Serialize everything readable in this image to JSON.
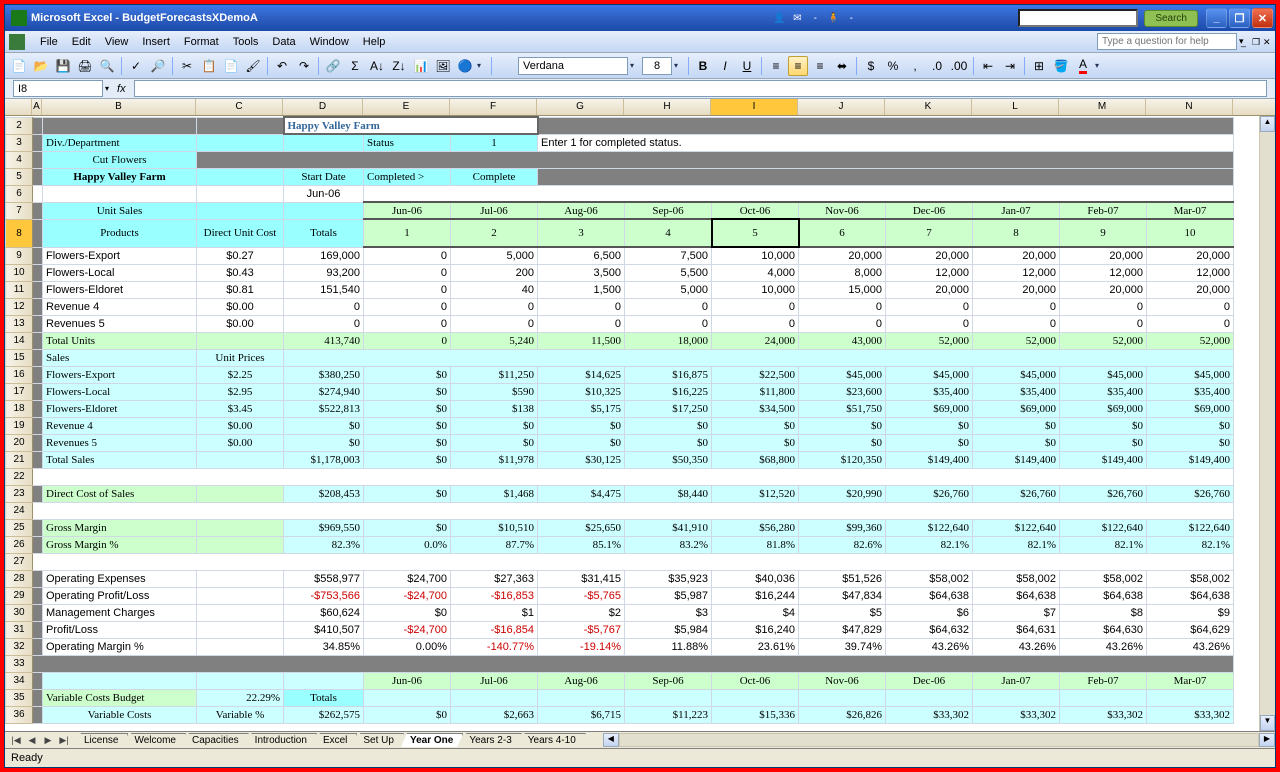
{
  "title": "Microsoft Excel - BudgetForecastsXDemoA",
  "search_btn": "Search",
  "menus": [
    "File",
    "Edit",
    "View",
    "Insert",
    "Format",
    "Tools",
    "Data",
    "Window",
    "Help"
  ],
  "help_placeholder": "Type a question for help",
  "font_name": "Verdana",
  "font_size": "8",
  "namebox": "I8",
  "columns": [
    "A",
    "B",
    "C",
    "D",
    "E",
    "F",
    "G",
    "H",
    "I",
    "J",
    "K",
    "L",
    "M",
    "N"
  ],
  "active_col": "I",
  "row_nums": [
    "2",
    "3",
    "4",
    "5",
    "6",
    "7",
    "8",
    "9",
    "10",
    "11",
    "12",
    "13",
    "14",
    "15",
    "16",
    "17",
    "18",
    "19",
    "20",
    "21",
    "22",
    "23",
    "24",
    "25",
    "26",
    "27",
    "28",
    "29",
    "30",
    "31",
    "32",
    "33",
    "34",
    "35",
    "36"
  ],
  "active_row": "8",
  "company": "Happy Valley Farm",
  "div_label": "Div./Department",
  "cut_flowers": "Cut Flowers",
  "status_label": "Status",
  "status_val": "1",
  "status_note": "Enter 1 for completed status.",
  "start_date": "Start Date",
  "completed_arrow": "Completed >",
  "completed": "Complete",
  "month0": "Jun-06",
  "unit_sales": "Unit Sales",
  "products": "Products",
  "direct_cost": "Direct Unit Cost",
  "totals": "Totals",
  "months": [
    "Jun-06",
    "Jul-06",
    "Aug-06",
    "Sep-06",
    "Oct-06",
    "Nov-06",
    "Dec-06",
    "Jan-07",
    "Feb-07",
    "Mar-07"
  ],
  "month_nums": [
    "1",
    "2",
    "3",
    "4",
    "5",
    "6",
    "7",
    "8",
    "9",
    "10"
  ],
  "chart_data": {
    "type": "table",
    "rows": [
      {
        "label": "Flowers-Export",
        "cost": "$0.27",
        "total": "169,000",
        "vals": [
          "0",
          "5,000",
          "6,500",
          "7,500",
          "10,000",
          "20,000",
          "20,000",
          "20,000",
          "20,000",
          "20,000"
        ]
      },
      {
        "label": "Flowers-Local",
        "cost": "$0.43",
        "total": "93,200",
        "vals": [
          "0",
          "200",
          "3,500",
          "5,500",
          "4,000",
          "8,000",
          "12,000",
          "12,000",
          "12,000",
          "12,000"
        ]
      },
      {
        "label": "Flowers-Eldoret",
        "cost": "$0.81",
        "total": "151,540",
        "vals": [
          "0",
          "40",
          "1,500",
          "5,000",
          "10,000",
          "15,000",
          "20,000",
          "20,000",
          "20,000",
          "20,000"
        ]
      },
      {
        "label": "Revenue 4",
        "cost": "$0.00",
        "total": "0",
        "vals": [
          "0",
          "0",
          "0",
          "0",
          "0",
          "0",
          "0",
          "0",
          "0",
          "0"
        ]
      },
      {
        "label": "Revenues 5",
        "cost": "$0.00",
        "total": "0",
        "vals": [
          "0",
          "0",
          "0",
          "0",
          "0",
          "0",
          "0",
          "0",
          "0",
          "0"
        ]
      }
    ],
    "total_units": {
      "label": "Total Units",
      "total": "413,740",
      "vals": [
        "0",
        "5,240",
        "11,500",
        "18,000",
        "24,000",
        "43,000",
        "52,000",
        "52,000",
        "52,000",
        "52,000"
      ]
    },
    "sales_hdr": "Sales",
    "unit_prices": "Unit Prices",
    "sales": [
      {
        "label": "Flowers-Export",
        "price": "$2.25",
        "total": "$380,250",
        "vals": [
          "$0",
          "$11,250",
          "$14,625",
          "$16,875",
          "$22,500",
          "$45,000",
          "$45,000",
          "$45,000",
          "$45,000",
          "$45,000"
        ]
      },
      {
        "label": "Flowers-Local",
        "price": "$2.95",
        "total": "$274,940",
        "vals": [
          "$0",
          "$590",
          "$10,325",
          "$16,225",
          "$11,800",
          "$23,600",
          "$35,400",
          "$35,400",
          "$35,400",
          "$35,400"
        ]
      },
      {
        "label": "Flowers-Eldoret",
        "price": "$3.45",
        "total": "$522,813",
        "vals": [
          "$0",
          "$138",
          "$5,175",
          "$17,250",
          "$34,500",
          "$51,750",
          "$69,000",
          "$69,000",
          "$69,000",
          "$69,000"
        ]
      },
      {
        "label": "Revenue 4",
        "price": "$0.00",
        "total": "$0",
        "vals": [
          "$0",
          "$0",
          "$0",
          "$0",
          "$0",
          "$0",
          "$0",
          "$0",
          "$0",
          "$0"
        ]
      },
      {
        "label": "Revenues 5",
        "price": "$0.00",
        "total": "$0",
        "vals": [
          "$0",
          "$0",
          "$0",
          "$0",
          "$0",
          "$0",
          "$0",
          "$0",
          "$0",
          "$0"
        ]
      }
    ],
    "total_sales": {
      "label": "Total Sales",
      "total": "$1,178,003",
      "vals": [
        "$0",
        "$11,978",
        "$30,125",
        "$50,350",
        "$68,800",
        "$120,350",
        "$149,400",
        "$149,400",
        "$149,400",
        "$149,400"
      ]
    },
    "dcs": {
      "label": "Direct Cost of Sales",
      "total": "$208,453",
      "vals": [
        "$0",
        "$1,468",
        "$4,475",
        "$8,440",
        "$12,520",
        "$20,990",
        "$26,760",
        "$26,760",
        "$26,760",
        "$26,760"
      ]
    },
    "gm": {
      "label": "Gross Margin",
      "total": "$969,550",
      "vals": [
        "$0",
        "$10,510",
        "$25,650",
        "$41,910",
        "$56,280",
        "$99,360",
        "$122,640",
        "$122,640",
        "$122,640",
        "$122,640"
      ]
    },
    "gmp": {
      "label": "Gross Margin %",
      "total": "82.3%",
      "vals": [
        "0.0%",
        "87.7%",
        "85.1%",
        "83.2%",
        "81.8%",
        "82.6%",
        "82.1%",
        "82.1%",
        "82.1%",
        "82.1%"
      ]
    },
    "opex": {
      "label": "Operating Expenses",
      "total": "$558,977",
      "vals": [
        "$24,700",
        "$27,363",
        "$31,415",
        "$35,923",
        "$40,036",
        "$51,526",
        "$58,002",
        "$58,002",
        "$58,002",
        "$58,002"
      ]
    },
    "opl": {
      "label": "Operating Profit/Loss",
      "total": "-$753,566",
      "vals": [
        "-$24,700",
        "-$16,853",
        "-$5,765",
        "$5,987",
        "$16,244",
        "$47,834",
        "$64,638",
        "$64,638",
        "$64,638",
        "$64,638"
      ],
      "neg": [
        true,
        true,
        true,
        true,
        false,
        false,
        false,
        false,
        false,
        false,
        false
      ]
    },
    "mc": {
      "label": "Management Charges",
      "total": "$60,624",
      "vals": [
        "$0",
        "$1",
        "$2",
        "$3",
        "$4",
        "$5",
        "$6",
        "$7",
        "$8",
        "$9"
      ]
    },
    "pl": {
      "label": "Profit/Loss",
      "total": "$410,507",
      "vals": [
        "-$24,700",
        "-$16,854",
        "-$5,767",
        "$5,984",
        "$16,240",
        "$47,829",
        "$64,632",
        "$64,631",
        "$64,630",
        "$64,629"
      ],
      "neg": [
        false,
        true,
        true,
        true,
        false,
        false,
        false,
        false,
        false,
        false,
        false
      ]
    },
    "omp": {
      "label": "Operating Margin %",
      "total": "34.85%",
      "vals": [
        "0.00%",
        "-140.77%",
        "-19.14%",
        "11.88%",
        "23.61%",
        "39.74%",
        "43.26%",
        "43.26%",
        "43.26%",
        "43.26%"
      ],
      "neg": [
        false,
        false,
        true,
        true,
        false,
        false,
        false,
        false,
        false,
        false,
        false
      ]
    },
    "vcb": {
      "label": "Variable Costs Budget",
      "pct": "22.29%",
      "totals": "Totals"
    },
    "vc": {
      "label": "Variable Costs",
      "sub": "Variable %",
      "total": "$262,575",
      "vals": [
        "$0",
        "$2,663",
        "$6,715",
        "$11,223",
        "$15,336",
        "$26,826",
        "$33,302",
        "$33,302",
        "$33,302",
        "$33,302"
      ]
    }
  },
  "tabs": [
    "License",
    "Welcome",
    "Capacities",
    "Introduction",
    "Excel",
    "Set Up",
    "Year One",
    "Years 2-3",
    "Years 4-10"
  ],
  "active_tab": "Year One",
  "status": "Ready"
}
